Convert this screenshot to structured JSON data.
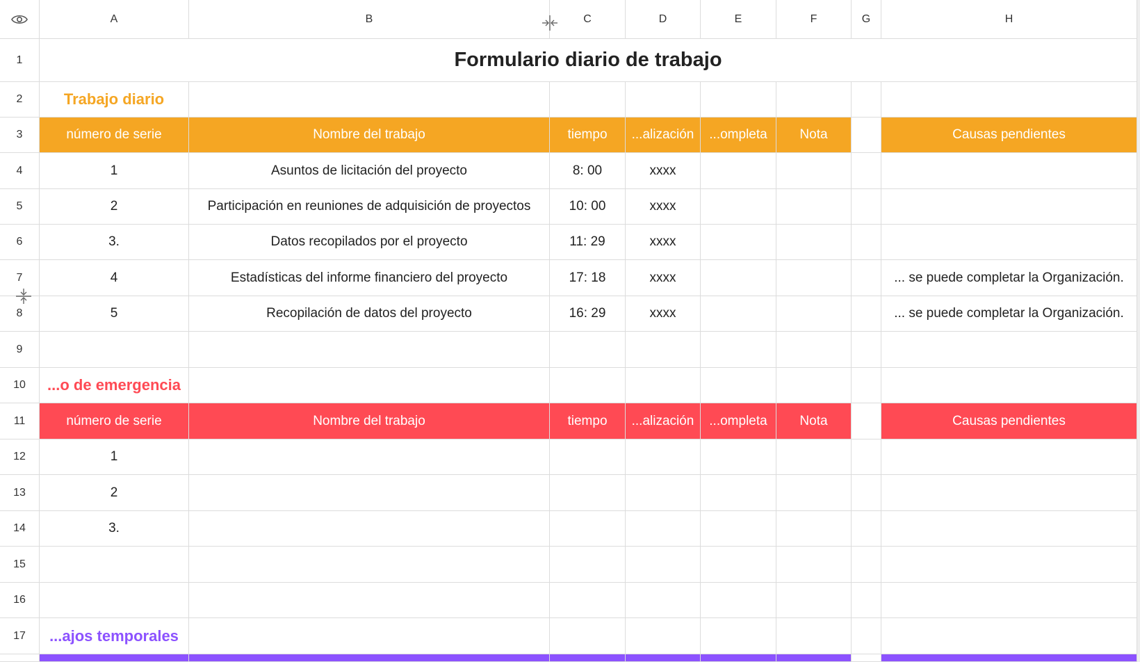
{
  "columns": [
    "A",
    "B",
    "C",
    "D",
    "E",
    "F",
    "G",
    "H"
  ],
  "rows": [
    "1",
    "2",
    "3",
    "4",
    "5",
    "6",
    "7",
    "8",
    "9",
    "10",
    "11",
    "12",
    "13",
    "14",
    "15",
    "16",
    "17"
  ],
  "title": "Formulario diario de trabajo",
  "sections": {
    "daily": "Trabajo diario",
    "emergency": "...o de emergencia",
    "temporary": "...ajos temporales"
  },
  "headers": {
    "serial": "número de serie",
    "name": "Nombre del trabajo",
    "time": "tiempo",
    "realization": "...alización",
    "complete": "...ompleta",
    "note": "Nota",
    "pending": "Causas pendientes"
  },
  "daily_rows": [
    {
      "serial": "1",
      "name": "Asuntos de licitación del proyecto",
      "time": "8: 00",
      "realization": "xxxx",
      "pending": ""
    },
    {
      "serial": "2",
      "name": "Participación en reuniones de adquisición de proyectos",
      "time": "10: 00",
      "realization": "xxxx",
      "pending": ""
    },
    {
      "serial": "3.",
      "name": "Datos recopilados por el proyecto",
      "time": "11: 29",
      "realization": "xxxx",
      "pending": ""
    },
    {
      "serial": "4",
      "name": "Estadísticas del informe financiero del proyecto",
      "time": "17: 18",
      "realization": "xxxx",
      "pending": "... se puede completar la Organización."
    },
    {
      "serial": "5",
      "name": "Recopilación de datos del proyecto",
      "time": "16: 29",
      "realization": "xxxx",
      "pending": "... se puede completar la Organización."
    }
  ],
  "emergency_rows": [
    {
      "serial": "1"
    },
    {
      "serial": "2"
    },
    {
      "serial": "3."
    }
  ],
  "colors": {
    "orange": "#f5a623",
    "red": "#ff4a54",
    "purple": "#8c52ff"
  },
  "icons": {
    "corner": "eye-icon",
    "column_resize": "column-resize-icon",
    "row_resize": "row-resize-icon"
  }
}
